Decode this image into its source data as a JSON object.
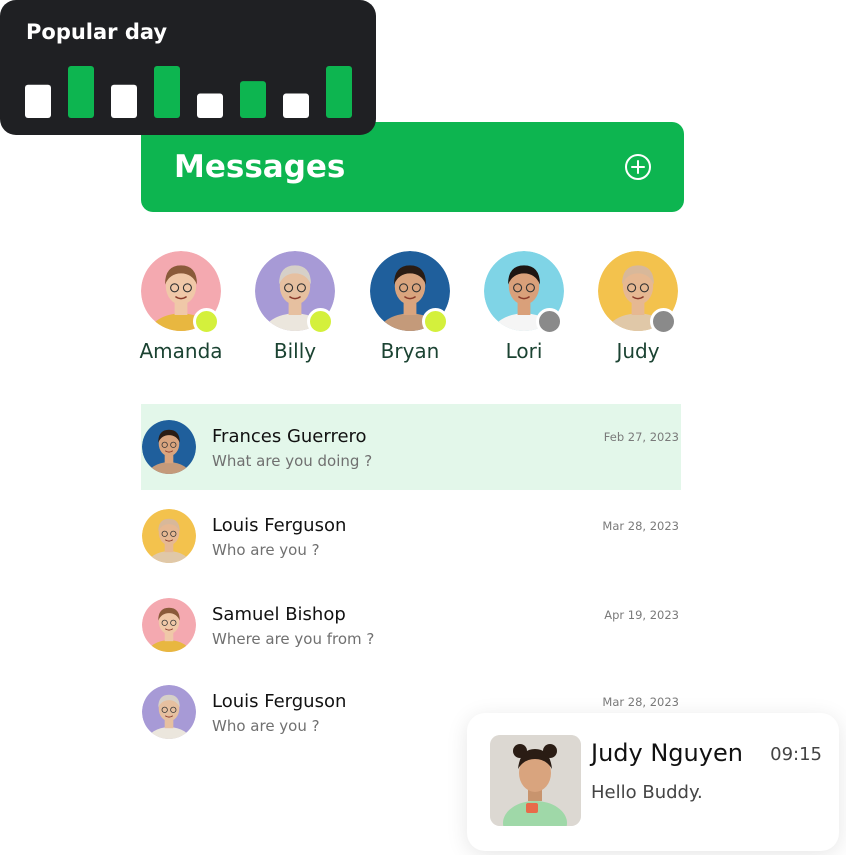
{
  "popular_day": {
    "title": "Popular day",
    "bars": [
      {
        "level": 0.64,
        "color": "#ffffff"
      },
      {
        "level": 1.0,
        "color": "#0db550"
      },
      {
        "level": 0.64,
        "color": "#ffffff"
      },
      {
        "level": 1.0,
        "color": "#0db550"
      },
      {
        "level": 0.47,
        "color": "#ffffff"
      },
      {
        "level": 0.71,
        "color": "#0db550"
      },
      {
        "level": 0.47,
        "color": "#ffffff"
      },
      {
        "level": 1.0,
        "color": "#0db550"
      }
    ]
  },
  "messages_header": {
    "title": "Messages",
    "add_icon": "plus-circle-icon",
    "color": "#0db550"
  },
  "stories": [
    {
      "name": "Amanda",
      "online": true,
      "bg": "#f4a9b0",
      "shirt": "#e8b740",
      "skin": "#f0c8a8",
      "hair": "#8a5a3a"
    },
    {
      "name": "Billy",
      "online": true,
      "bg": "#a79ad6",
      "shirt": "#ebe6dd",
      "skin": "#e6c0a0",
      "hair": "#d6d0c8"
    },
    {
      "name": "Bryan",
      "online": true,
      "bg": "#1f5f9c",
      "shirt": "#c49a7a",
      "skin": "#d9a47e",
      "hair": "#2a1c14"
    },
    {
      "name": "Lori",
      "online": false,
      "bg": "#7fd4e6",
      "shirt": "#f5f5f5",
      "skin": "#d9a07a",
      "hair": "#1d1512"
    },
    {
      "name": "Judy",
      "online": false,
      "bg": "#f3c24d",
      "shirt": "#e0c8a8",
      "skin": "#e6b892",
      "hair": "#d8b89a"
    }
  ],
  "status_colors": {
    "online": "#d4f03c",
    "offline": "#8a8a8a"
  },
  "chats": [
    {
      "name": "Frances Guerrero",
      "message": "What are you doing ?",
      "date": "Feb 27, 2023",
      "active": true,
      "bg": "#1f5f9c",
      "shirt": "#c49a7a",
      "skin": "#d9a47e",
      "hair": "#2a1c14"
    },
    {
      "name": "Louis Ferguson",
      "message": "Who are you ?",
      "date": "Mar 28, 2023",
      "active": false,
      "bg": "#f3c24d",
      "shirt": "#e0c8a8",
      "skin": "#e6b892",
      "hair": "#d8b89a"
    },
    {
      "name": "Samuel Bishop",
      "message": "Where are you from ?",
      "date": "Apr 19, 2023",
      "active": false,
      "bg": "#f4a9b0",
      "shirt": "#e8b740",
      "skin": "#f0c8a8",
      "hair": "#8a5a3a"
    },
    {
      "name": "Louis Ferguson",
      "message": "Who are you ?",
      "date": "Mar 28, 2023",
      "active": false,
      "bg": "#a79ad6",
      "shirt": "#ebe6dd",
      "skin": "#e6c0a0",
      "hair": "#d6d0c8"
    }
  ],
  "notification": {
    "name": "Judy Nguyen",
    "time": "09:15",
    "message": "Hello Buddy."
  }
}
